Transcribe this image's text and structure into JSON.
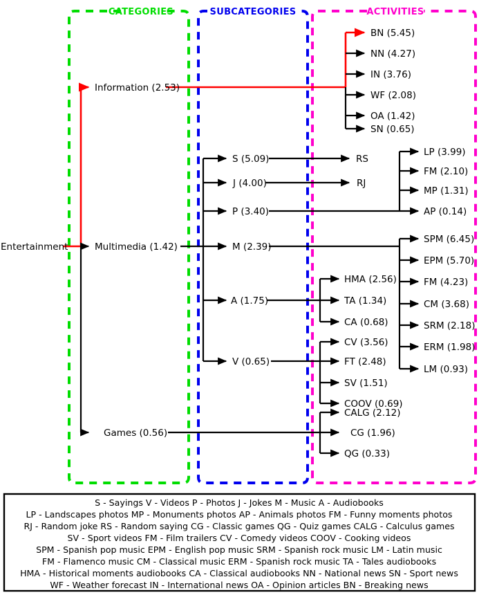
{
  "columns": [
    {
      "id": "categories",
      "label": "CATEGORIES",
      "color": "#00dd00"
    },
    {
      "id": "subcategories",
      "label": "SUBCATEGORIES",
      "color": "#0000ee"
    },
    {
      "id": "activities",
      "label": "ACTIVITIES",
      "color": "#ff00cc"
    }
  ],
  "colors": {
    "categories_box": "#00dd00",
    "subcategories_box": "#0000ee",
    "activities_box": "#ff00cc",
    "highlight_path": "#ff0000",
    "edge": "#000000",
    "node_text": "#000000"
  },
  "chart_data": {
    "type": "diagram",
    "title": "",
    "root": {
      "label": "Entertainment",
      "value": null,
      "display": "Entertainment"
    },
    "nodes": [
      {
        "id": "information",
        "label": "Information",
        "value": "2.53",
        "display": "Information (2.53)",
        "column": "categories",
        "highlighted": true
      },
      {
        "id": "multimedia",
        "label": "Multimedia",
        "value": "1.42",
        "display": "Multimedia (1.42)",
        "column": "categories",
        "highlighted": false
      },
      {
        "id": "games",
        "label": "Games",
        "value": "0.56",
        "display": "Games (0.56)",
        "column": "categories",
        "highlighted": false
      },
      {
        "id": "S",
        "label": "S",
        "value": "5.09",
        "display": "S (5.09)",
        "column": "subcategories",
        "parent": "multimedia"
      },
      {
        "id": "J",
        "label": "J",
        "value": "4.00",
        "display": "J (4.00)",
        "column": "subcategories",
        "parent": "multimedia"
      },
      {
        "id": "P",
        "label": "P",
        "value": "3.40",
        "display": "P (3.40)",
        "column": "subcategories",
        "parent": "multimedia"
      },
      {
        "id": "M",
        "label": "M",
        "value": "2.39",
        "display": "M (2.39)",
        "column": "subcategories",
        "parent": "multimedia"
      },
      {
        "id": "A",
        "label": "A",
        "value": "1.75",
        "display": "A (1.75)",
        "column": "subcategories",
        "parent": "multimedia"
      },
      {
        "id": "V",
        "label": "V",
        "value": "0.65",
        "display": "V (0.65)",
        "column": "subcategories",
        "parent": "multimedia"
      },
      {
        "id": "BN",
        "label": "BN",
        "value": "5.45",
        "display": "BN (5.45)",
        "column": "activities",
        "parent": "information",
        "highlighted": true
      },
      {
        "id": "NN",
        "label": "NN",
        "value": "4.27",
        "display": "NN (4.27)",
        "column": "activities",
        "parent": "information"
      },
      {
        "id": "IN",
        "label": "IN",
        "value": "3.76",
        "display": "IN (3.76)",
        "column": "activities",
        "parent": "information"
      },
      {
        "id": "WF",
        "label": "WF",
        "value": "2.08",
        "display": "WF (2.08)",
        "column": "activities",
        "parent": "information"
      },
      {
        "id": "OA",
        "label": "OA",
        "value": "1.42",
        "display": "OA (1.42)",
        "column": "activities",
        "parent": "information"
      },
      {
        "id": "SN",
        "label": "SN",
        "value": "0.65",
        "display": "SN (0.65)",
        "column": "activities",
        "parent": "information"
      },
      {
        "id": "RS",
        "label": "RS",
        "value": null,
        "display": "RS",
        "column": "activities",
        "parent": "S"
      },
      {
        "id": "RJ",
        "label": "RJ",
        "value": null,
        "display": "RJ",
        "column": "activities",
        "parent": "J"
      },
      {
        "id": "LP",
        "label": "LP",
        "value": "3.99",
        "display": "LP (3.99)",
        "column": "activities",
        "parent": "P"
      },
      {
        "id": "FMP",
        "label": "FM",
        "value": "2.10",
        "display": "FM (2.10)",
        "column": "activities",
        "parent": "P"
      },
      {
        "id": "MP",
        "label": "MP",
        "value": "1.31",
        "display": "MP (1.31)",
        "column": "activities",
        "parent": "P"
      },
      {
        "id": "AP",
        "label": "AP",
        "value": "0.14",
        "display": "AP (0.14)",
        "column": "activities",
        "parent": "P"
      },
      {
        "id": "SPM",
        "label": "SPM",
        "value": "6.45",
        "display": "SPM (6.45)",
        "column": "activities",
        "parent": "M"
      },
      {
        "id": "EPM",
        "label": "EPM",
        "value": "5.70",
        "display": "EPM (5.70)",
        "column": "activities",
        "parent": "M"
      },
      {
        "id": "FMM",
        "label": "FM",
        "value": "4.23",
        "display": "FM (4.23)",
        "column": "activities",
        "parent": "M"
      },
      {
        "id": "CM",
        "label": "CM",
        "value": "3.68",
        "display": "CM (3.68)",
        "column": "activities",
        "parent": "M"
      },
      {
        "id": "SRM",
        "label": "SRM",
        "value": "2.18",
        "display": "SRM (2.18)",
        "column": "activities",
        "parent": "M"
      },
      {
        "id": "ERM",
        "label": "ERM",
        "value": "1.98",
        "display": "ERM (1.98)",
        "column": "activities",
        "parent": "M"
      },
      {
        "id": "LM",
        "label": "LM",
        "value": "0.93",
        "display": "LM (0.93)",
        "column": "activities",
        "parent": "M"
      },
      {
        "id": "HMA",
        "label": "HMA",
        "value": "2.56",
        "display": "HMA (2.56)",
        "column": "activities",
        "parent": "A"
      },
      {
        "id": "TA",
        "label": "TA",
        "value": "1.34",
        "display": "TA (1.34)",
        "column": "activities",
        "parent": "A"
      },
      {
        "id": "CA",
        "label": "CA",
        "value": "0.68",
        "display": "CA (0.68)",
        "column": "activities",
        "parent": "A"
      },
      {
        "id": "CV",
        "label": "CV",
        "value": "3.56",
        "display": "CV (3.56)",
        "column": "activities",
        "parent": "V"
      },
      {
        "id": "FT",
        "label": "FT",
        "value": "2.48",
        "display": "FT (2.48)",
        "column": "activities",
        "parent": "V"
      },
      {
        "id": "SV",
        "label": "SV",
        "value": "1.51",
        "display": "SV (1.51)",
        "column": "activities",
        "parent": "V"
      },
      {
        "id": "COOV",
        "label": "COOV",
        "value": "0.69",
        "display": "COOV (0.69)",
        "column": "activities",
        "parent": "V"
      },
      {
        "id": "CALG",
        "label": "CALG",
        "value": "2.12",
        "display": "CALG (2.12)",
        "column": "activities",
        "parent": "games"
      },
      {
        "id": "CG",
        "label": "CG",
        "value": "1.96",
        "display": "CG (1.96)",
        "column": "activities",
        "parent": "games"
      },
      {
        "id": "QG",
        "label": "QG",
        "value": "0.33",
        "display": "QG (0.33)",
        "column": "activities",
        "parent": "games"
      }
    ]
  },
  "legend": {
    "lines": [
      "S - Sayings    V - Videos    P - Photos    J - Jokes    M - Music    A - Audiobooks",
      "LP - Landscapes photos    MP - Monuments photos    AP - Animals photos    FM - Funny moments photos",
      "RJ - Random joke    RS - Random saying    CG - Classic games    QG - Quiz games    CALG - Calculus games",
      "SV - Sport videos    FM - Film trailers    CV - Comedy videos    COOV - Cooking videos",
      "SPM - Spanish pop music    EPM - English pop music    SRM - Spanish rock music    LM - Latin music",
      "FM - Flamenco music    CM - Classical music    ERM - Spanish rock music    TA - Tales audiobooks",
      "HMA - Historical moments audiobooks    CA - Classical audiobooks    NN - National news    SN - Sport news",
      "WF - Weather forecast    IN - International news    OA - Opinion articles    BN - Breaking news"
    ]
  }
}
